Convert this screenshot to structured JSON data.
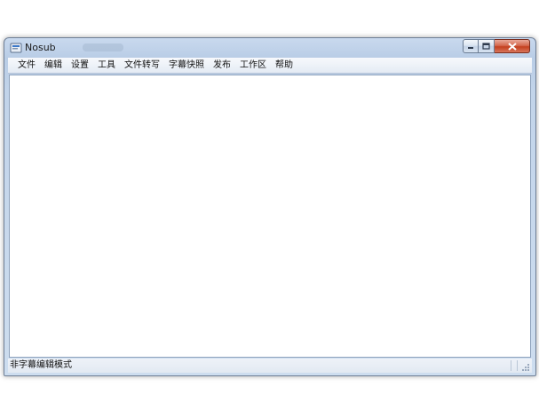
{
  "window": {
    "title": "Nosub",
    "accent": "#b9cde6",
    "close_color": "#c4401f"
  },
  "caption_buttons": [
    {
      "name": "minimize",
      "icon": "minimize-icon"
    },
    {
      "name": "maximize",
      "icon": "maximize-icon"
    },
    {
      "name": "close",
      "icon": "close-icon"
    }
  ],
  "menu": {
    "items": [
      "文件",
      "编辑",
      "设置",
      "工具",
      "文件转写",
      "字幕快照",
      "发布",
      "工作区",
      "帮助"
    ]
  },
  "status": {
    "text": "非字幕编辑模式"
  }
}
